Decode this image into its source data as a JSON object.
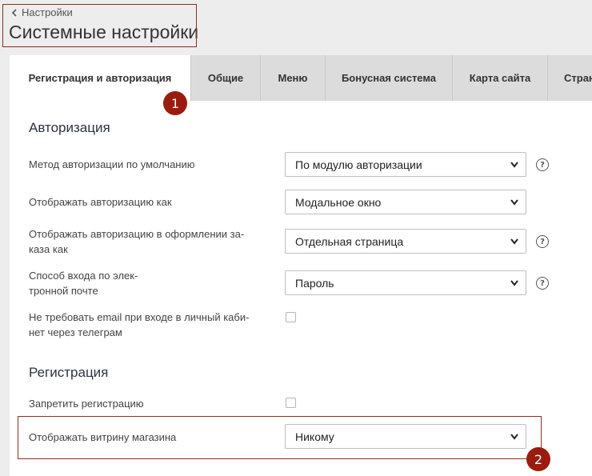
{
  "header": {
    "breadcrumb": "Настройки",
    "title": "Системные настройки"
  },
  "tabs": [
    {
      "label": "Регистрация и авторизация",
      "active": true
    },
    {
      "label": "Общие"
    },
    {
      "label": "Меню"
    },
    {
      "label": "Бонусная система"
    },
    {
      "label": "Карта сайта"
    },
    {
      "label": "Стран"
    }
  ],
  "callouts": [
    "1",
    "2"
  ],
  "auth": {
    "title": "Авторизация",
    "rows": [
      {
        "label": "Метод авторизации по умолчанию",
        "value": "По модулю авторизации"
      },
      {
        "label": "Отображать авторизацию как",
        "value": "Модальное окно"
      },
      {
        "label": "Отображать авторизацию в оформлении за-\nказа как",
        "value": "Отдельная страница"
      },
      {
        "label": "Способ входа по элек-\nтронной почте",
        "value": "Пароль"
      },
      {
        "label": "Не требовать email при входе в личный каби-\nнет через телеграм"
      }
    ]
  },
  "registration": {
    "title": "Регистрация",
    "rows": [
      {
        "label": "Запретить регистрацию"
      },
      {
        "label": "Отображать витрину магазина",
        "value": "Никому"
      }
    ]
  },
  "help_glyph": "?",
  "colors": {
    "accent": "#9b1c0e",
    "callout_border": "#8b2e1f"
  }
}
